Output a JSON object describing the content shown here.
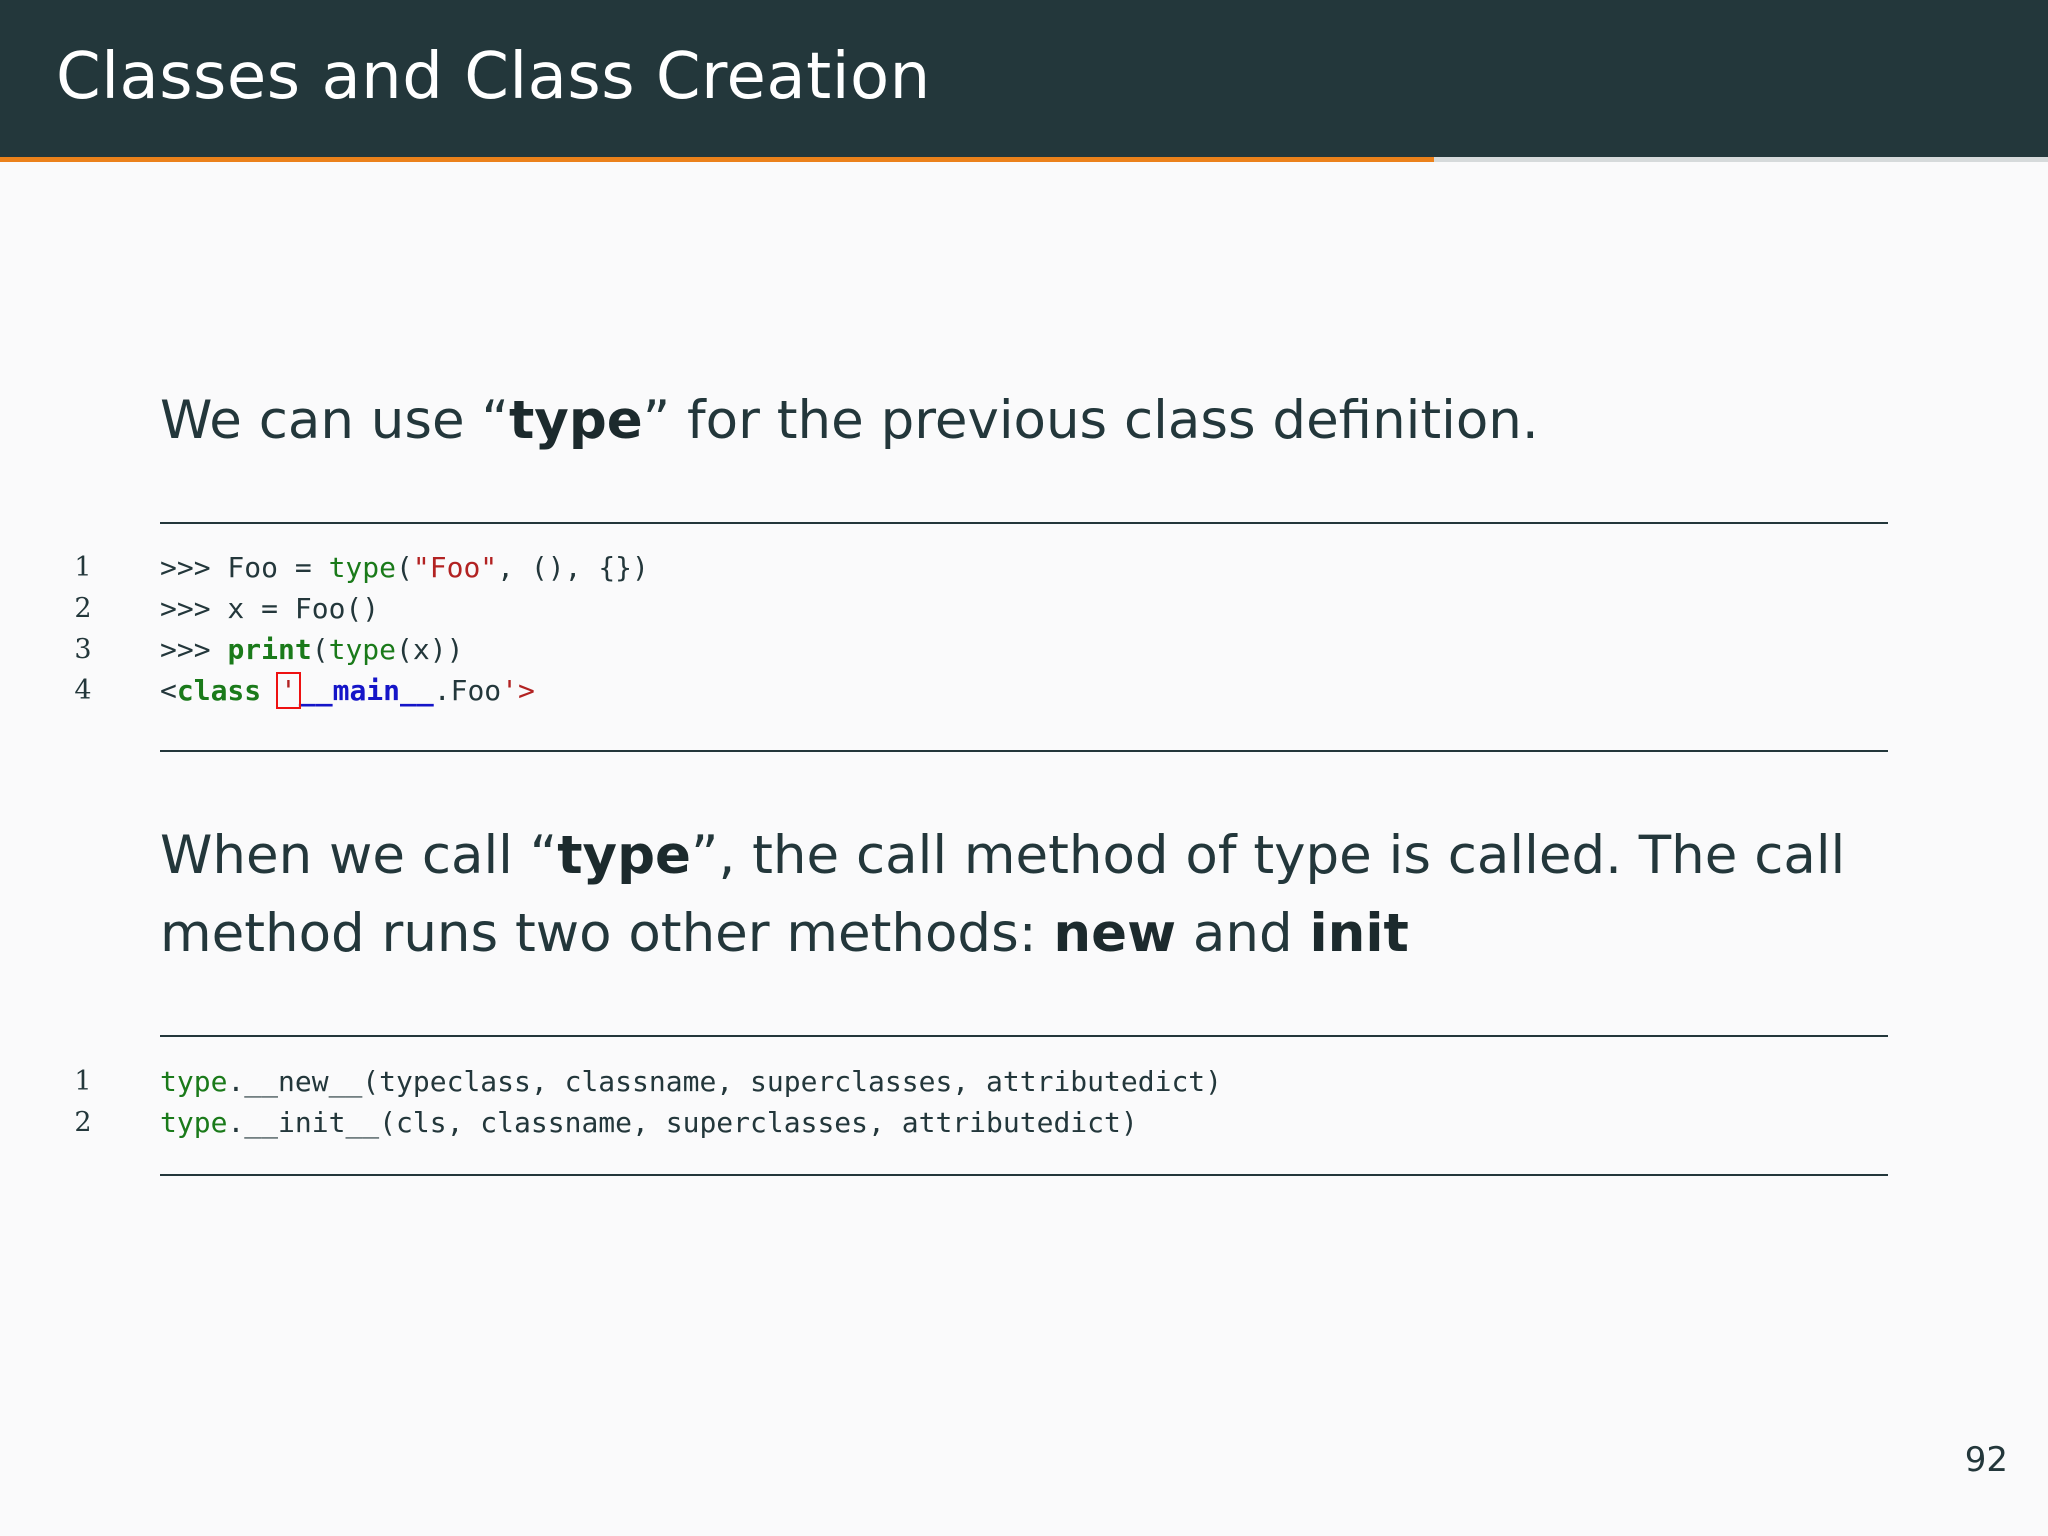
{
  "slide": {
    "title": "Classes and Class Creation",
    "progress": 0.7,
    "page_number": "92"
  },
  "paragraph1": {
    "prefix": "We can use “",
    "bold": "type",
    "suffix": "” for the previous class definition."
  },
  "code1": {
    "lines": [
      {
        "number": "1",
        "tokens": [
          {
            "text": ">>> Foo = ",
            "kind": "plain"
          },
          {
            "text": "type",
            "kind": "kw"
          },
          {
            "text": "(",
            "kind": "plain"
          },
          {
            "text": "\"Foo\"",
            "kind": "str"
          },
          {
            "text": ", (), {})",
            "kind": "plain"
          }
        ]
      },
      {
        "number": "2",
        "tokens": [
          {
            "text": ">>> x = Foo()",
            "kind": "plain"
          }
        ]
      },
      {
        "number": "3",
        "tokens": [
          {
            "text": ">>> ",
            "kind": "plain"
          },
          {
            "text": "print",
            "kind": "kwb"
          },
          {
            "text": "(",
            "kind": "plain"
          },
          {
            "text": "type",
            "kind": "kw"
          },
          {
            "text": "(x))",
            "kind": "plain"
          }
        ]
      },
      {
        "number": "4",
        "tokens": [
          {
            "text": "<",
            "kind": "plain"
          },
          {
            "text": "class",
            "kind": "kwb"
          },
          {
            "text": " ",
            "kind": "plain"
          },
          {
            "text": "'",
            "kind": "err"
          },
          {
            "text": "__main__",
            "kind": "nm"
          },
          {
            "text": ".Foo",
            "kind": "plain"
          },
          {
            "text": "'>",
            "kind": "str"
          }
        ]
      }
    ]
  },
  "paragraph2": {
    "line1_prefix": "When we call “",
    "line1_bold": "type",
    "line1_suffix": "”, the call method of type is called. The call",
    "line2_prefix": "method runs two other methods: ",
    "line2_bold1": "new",
    "line2_mid": " and ",
    "line2_bold2": "init"
  },
  "code2": {
    "lines": [
      {
        "number": "1",
        "tokens": [
          {
            "text": "type",
            "kind": "kw"
          },
          {
            "text": ".__new__(typeclass, classname, superclasses, attributedict)",
            "kind": "plain"
          }
        ]
      },
      {
        "number": "2",
        "tokens": [
          {
            "text": "type",
            "kind": "kw"
          },
          {
            "text": ".__init__(cls, classname, superclasses, attributedict)",
            "kind": "plain"
          }
        ]
      }
    ]
  }
}
